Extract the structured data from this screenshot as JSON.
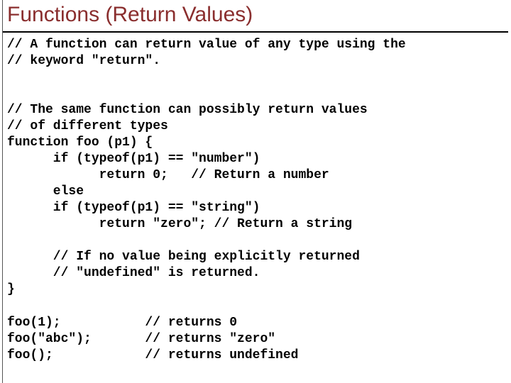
{
  "title": "Functions (Return Values)",
  "code": {
    "l01": "// A function can return value of any type using the",
    "l02": "// keyword \"return\".",
    "l03": "",
    "l04": "",
    "l05": "// The same function can possibly return values",
    "l06": "// of different types",
    "l07": "function foo (p1) {",
    "l08": "      if (typeof(p1) == \"number\")",
    "l09": "            return 0;   // Return a number",
    "l10": "      else",
    "l11": "      if (typeof(p1) == \"string\")",
    "l12": "            return \"zero\"; // Return a string",
    "l13": "",
    "l14": "      // If no value being explicitly returned",
    "l15": "      // \"undefined\" is returned.",
    "l16": "}",
    "l17": "",
    "l18": "foo(1);           // returns 0",
    "l19": "foo(\"abc\");       // returns \"zero\"",
    "l20": "foo();            // returns undefined"
  }
}
